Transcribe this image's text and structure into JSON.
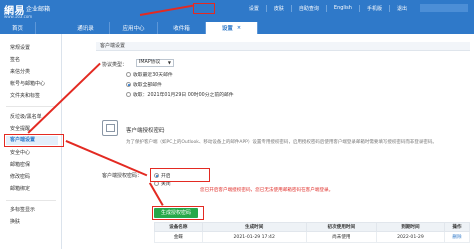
{
  "header": {
    "logo": "網易",
    "product": "企业邮箱",
    "url": "www.163.com",
    "links": [
      "设置",
      "皮肤",
      "自助查询",
      "English",
      "手机版",
      "退出"
    ]
  },
  "nav": {
    "tabs": [
      {
        "label": "首页"
      },
      {
        "label": "通讯录"
      },
      {
        "label": "应用中心"
      },
      {
        "label": "收件箱"
      },
      {
        "label": "设置",
        "close": "×"
      }
    ]
  },
  "sidebar": {
    "items": [
      "常规设置",
      "签名",
      "来信分类",
      "帐号与邮箱中心",
      "文件夹和标签",
      "反垃圾/黑名单",
      "安全提醒",
      "客户端设置",
      "安全中心",
      "邮箱密保",
      "修改密码",
      "邮箱绑定",
      "多标签显示",
      "换肤"
    ]
  },
  "main": {
    "section": "客户端设置",
    "protocol_label": "协议类型：",
    "protocol_value": "IMAP协议",
    "options": [
      {
        "label": "收取最近30天邮件",
        "selected": false
      },
      {
        "label": "收取全部邮件",
        "selected": true
      },
      {
        "label": "收取：2021年01月29日 00时00分之前的邮件",
        "selected": false
      }
    ],
    "card_title": "客户端授权密码",
    "description": "为了保护客户端（如PC上的Outlook、移动设备上的邮件APP）设置专用授权密码，启用授权密码后使用客户端登录邮箱时需要填写授权密码而非登录密码。",
    "auth_label": "客户端授权密码：",
    "auth_options": [
      {
        "label": "开启",
        "selected": true
      },
      {
        "label": "关闭",
        "selected": false
      }
    ],
    "hint": "您已开启客户端授权密码，您已无法使用邮箱密码在客户端登录。",
    "generate_button": "生成授权密码",
    "table": {
      "headers": [
        "设备名称",
        "生成时间",
        "初次使用时间",
        "到期时间",
        "操作"
      ],
      "rows": [
        [
          "金蝶",
          "2021-01-29 17:42",
          "尚未使用",
          "2022-01-29",
          "删除"
        ]
      ]
    }
  }
}
